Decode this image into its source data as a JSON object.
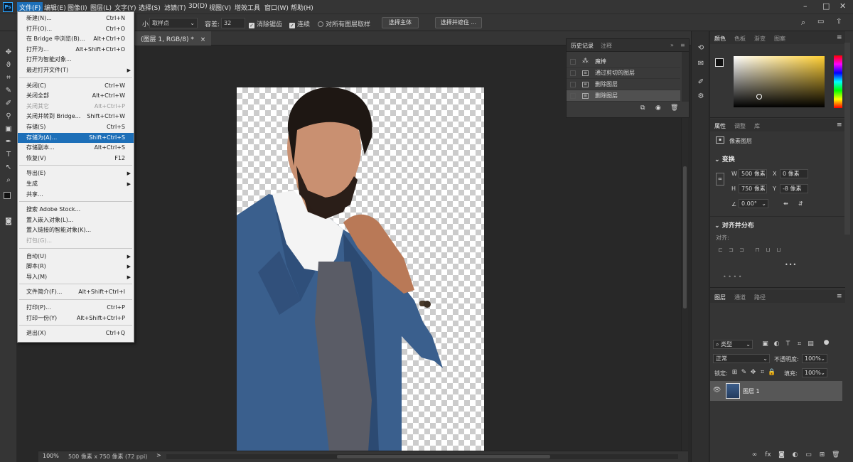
{
  "menubar": {
    "items": [
      "文件(F)",
      "编辑(E)",
      "图像(I)",
      "图层(L)",
      "文字(Y)",
      "选择(S)",
      "滤镜(T)",
      "3D(D)",
      "视图(V)",
      "增效工具",
      "窗口(W)",
      "帮助(H)"
    ],
    "logo": "Ps"
  },
  "options": {
    "sample_label": "小:",
    "sample_value": "取样点",
    "tolerance_label": "容差:",
    "tolerance_value": "32",
    "antialias": "消除锯齿",
    "contiguous": "连续",
    "all_layers": "对所有图层取样",
    "select_subject": "选择主体",
    "select_mask": "选择并遮住 ..."
  },
  "doc_tab": {
    "title": "(图层 1, RGB/8) *",
    "close": "×"
  },
  "file_menu": {
    "items": [
      {
        "label": "新建(N)...",
        "shortcut": "Ctrl+N"
      },
      {
        "label": "打开(O)...",
        "shortcut": "Ctrl+O"
      },
      {
        "label": "在 Bridge 中浏览(B)...",
        "shortcut": "Alt+Ctrl+O"
      },
      {
        "label": "打开为...",
        "shortcut": "Alt+Shift+Ctrl+O"
      },
      {
        "label": "打开为智能对象...",
        "shortcut": ""
      },
      {
        "label": "最近打开文件(T)",
        "shortcut": "",
        "submenu": true
      },
      {
        "sep": true
      },
      {
        "label": "关闭(C)",
        "shortcut": "Ctrl+W"
      },
      {
        "label": "关闭全部",
        "shortcut": "Alt+Ctrl+W"
      },
      {
        "label": "关闭其它",
        "shortcut": "Alt+Ctrl+P",
        "disabled": true
      },
      {
        "label": "关闭并转到 Bridge...",
        "shortcut": "Shift+Ctrl+W"
      },
      {
        "label": "存储(S)",
        "shortcut": "Ctrl+S"
      },
      {
        "label": "存储为(A)...",
        "shortcut": "Shift+Ctrl+S",
        "selected": true
      },
      {
        "label": "存储副本...",
        "shortcut": "Alt+Ctrl+S"
      },
      {
        "label": "恢复(V)",
        "shortcut": "F12"
      },
      {
        "sep": true
      },
      {
        "label": "导出(E)",
        "shortcut": "",
        "submenu": true
      },
      {
        "label": "生成",
        "shortcut": "",
        "submenu": true
      },
      {
        "label": "共享...",
        "shortcut": ""
      },
      {
        "sep": true
      },
      {
        "label": "搜索 Adobe Stock...",
        "shortcut": ""
      },
      {
        "label": "置入嵌入对象(L)...",
        "shortcut": ""
      },
      {
        "label": "置入链接的智能对象(K)...",
        "shortcut": ""
      },
      {
        "label": "打包(G)...",
        "shortcut": "",
        "disabled": true
      },
      {
        "sep": true
      },
      {
        "label": "自动(U)",
        "shortcut": "",
        "submenu": true
      },
      {
        "label": "脚本(R)",
        "shortcut": "",
        "submenu": true
      },
      {
        "label": "导入(M)",
        "shortcut": "",
        "submenu": true
      },
      {
        "sep": true
      },
      {
        "label": "文件简介(F)...",
        "shortcut": "Alt+Shift+Ctrl+I"
      },
      {
        "sep": true
      },
      {
        "label": "打印(P)...",
        "shortcut": "Ctrl+P"
      },
      {
        "label": "打印一份(Y)",
        "shortcut": "Alt+Shift+Ctrl+P"
      },
      {
        "sep": true
      },
      {
        "label": "退出(X)",
        "shortcut": "Ctrl+Q"
      }
    ]
  },
  "history": {
    "tabs": [
      "历史记录",
      "注释"
    ],
    "rows": [
      "魔棒",
      "通过剪切的图层",
      "删除图层",
      "删除图层"
    ]
  },
  "color_panel": {
    "tabs": [
      "颜色",
      "色板",
      "渐变",
      "图案"
    ]
  },
  "properties": {
    "tabs": [
      "属性",
      "调整",
      "库"
    ],
    "type": "像素图层",
    "transform_title": "变换",
    "w_label": "W",
    "w_value": "500 像素",
    "h_label": "H",
    "h_value": "750 像素",
    "x_label": "X",
    "x_value": "0 像素",
    "y_label": "Y",
    "y_value": "-8 像素",
    "angle": "0.00°",
    "align_title": "对齐并分布",
    "align_label": "对齐:",
    "more": "•••"
  },
  "layers": {
    "tabs": [
      "图层",
      "通道",
      "路径"
    ],
    "filter_kind": "类型",
    "blend_mode": "正常",
    "opacity_label": "不透明度:",
    "opacity_value": "100%",
    "lock_label": "锁定:",
    "fill_label": "填充:",
    "fill_value": "100%",
    "layer_name": "图层 1"
  },
  "status": {
    "zoom": "100%",
    "info": "500 像素 x 750 像素 (72 ppi)",
    "arrow": ">"
  }
}
